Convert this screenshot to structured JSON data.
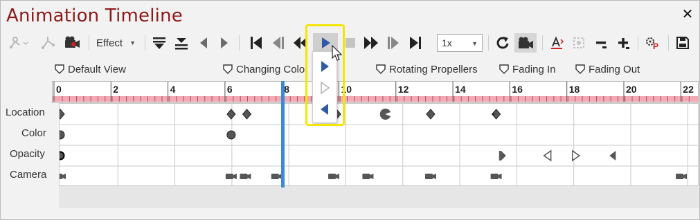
{
  "window": {
    "title": "Animation Timeline",
    "close_glyph": "✕"
  },
  "toolbar": {
    "effect_label": "Effect",
    "speed_value": "1x",
    "icons": [
      "motion-path-icon",
      "path-edit-icon",
      "camera-record-icon",
      "effect-dropdown",
      "collapse-rows-icon",
      "expand-rows-icon",
      "previous-keyframe-icon",
      "next-keyframe-icon",
      "go-to-start-icon",
      "step-back-icon",
      "rewind-icon",
      "play-icon",
      "stop-icon",
      "fast-forward-icon",
      "step-forward-icon",
      "go-to-end-icon",
      "speed-dropdown",
      "loop-icon",
      "camera-icon",
      "fit-text-icon",
      "zoom-fit-icon",
      "zoom-out-icon",
      "zoom-in-icon",
      "settings-icon",
      "save-icon"
    ]
  },
  "play_dropdown": {
    "items": [
      "play-forward-icon",
      "play-forward-outline-icon",
      "play-reverse-icon"
    ]
  },
  "markers": [
    {
      "label": "Default View"
    },
    {
      "label": "Changing Colo"
    },
    {
      "label": "Rotating Propellers"
    },
    {
      "label": "Fading In"
    },
    {
      "label": "Fading Out"
    }
  ],
  "ruler": {
    "ticks": [
      "0",
      "2",
      "4",
      "6",
      "8",
      "10",
      "12",
      "14",
      "16",
      "18",
      "20",
      "22"
    ],
    "playhead_time": 8
  },
  "tracks": [
    {
      "label": "Location"
    },
    {
      "label": "Color"
    },
    {
      "label": "Opacity"
    },
    {
      "label": "Camera"
    }
  ],
  "keyframes": {
    "Location": [
      {
        "t": 0,
        "shape": "diamond"
      },
      {
        "t": 6,
        "shape": "diamond"
      },
      {
        "t": 6.55,
        "shape": "diamond"
      },
      {
        "t": 9.7,
        "shape": "diamond"
      },
      {
        "t": 11.4,
        "shape": "pacman"
      },
      {
        "t": 13,
        "shape": "diamond"
      },
      {
        "t": 15.3,
        "shape": "diamond-star"
      }
    ],
    "Color": [
      {
        "t": 0,
        "shape": "circle"
      },
      {
        "t": 6,
        "shape": "circle"
      }
    ],
    "Opacity": [
      {
        "t": 0,
        "shape": "circle-bold"
      },
      {
        "t": 15.5,
        "shape": "flag-right"
      },
      {
        "t": 17.1,
        "shape": "tri-left-outline"
      },
      {
        "t": 18.1,
        "shape": "tri-right-outline"
      },
      {
        "t": 19.4,
        "shape": "tri-left"
      }
    ],
    "Camera": [
      {
        "t": 0,
        "shape": "camera"
      },
      {
        "t": 6,
        "shape": "camera"
      },
      {
        "t": 6.5,
        "shape": "camera"
      },
      {
        "t": 7.6,
        "shape": "camera"
      },
      {
        "t": 9.6,
        "shape": "camera"
      },
      {
        "t": 10.8,
        "shape": "camera"
      },
      {
        "t": 13,
        "shape": "camera"
      },
      {
        "t": 15.3,
        "shape": "camera"
      },
      {
        "t": 21.8,
        "shape": "camera"
      }
    ]
  },
  "colors": {
    "title": "#8b1a1a",
    "accent_blue": "#2f5aa8",
    "playhead": "#3a8ad6",
    "ruler_band": "#f2a9b3",
    "highlight": "#f5e600"
  }
}
